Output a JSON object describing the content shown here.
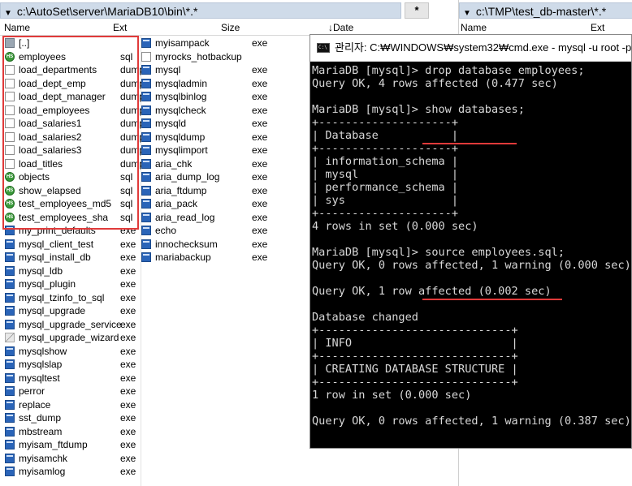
{
  "left_panel": {
    "path": "c:\\AutoSet\\server\\MariaDB10\\bin\\*.*",
    "columns": {
      "name": "Name",
      "ext": "Ext",
      "size": "Size",
      "date": "Date"
    },
    "sort_indicator": "↓",
    "col1": [
      {
        "name": "[..]",
        "ext": "",
        "icon": "up-folder-icon"
      },
      {
        "name": "employees",
        "ext": "sql",
        "icon": "sql-file-icon"
      },
      {
        "name": "load_departments",
        "ext": "dump",
        "icon": "document-icon"
      },
      {
        "name": "load_dept_emp",
        "ext": "dump",
        "icon": "document-icon"
      },
      {
        "name": "load_dept_manager",
        "ext": "dump",
        "icon": "document-icon"
      },
      {
        "name": "load_employees",
        "ext": "dump",
        "icon": "document-icon"
      },
      {
        "name": "load_salaries1",
        "ext": "dump",
        "icon": "document-icon"
      },
      {
        "name": "load_salaries2",
        "ext": "dump",
        "icon": "document-icon"
      },
      {
        "name": "load_salaries3",
        "ext": "dump",
        "icon": "document-icon"
      },
      {
        "name": "load_titles",
        "ext": "dump",
        "icon": "document-icon"
      },
      {
        "name": "objects",
        "ext": "sql",
        "icon": "sql-file-icon"
      },
      {
        "name": "show_elapsed",
        "ext": "sql",
        "icon": "sql-file-icon"
      },
      {
        "name": "test_employees_md5",
        "ext": "sql",
        "icon": "sql-file-icon"
      },
      {
        "name": "test_employees_sha",
        "ext": "sql",
        "icon": "sql-file-icon"
      },
      {
        "name": "my_print_defaults",
        "ext": "exe",
        "icon": "exe-file-icon"
      },
      {
        "name": "mysql_client_test",
        "ext": "exe",
        "icon": "exe-file-icon"
      },
      {
        "name": "mysql_install_db",
        "ext": "exe",
        "icon": "exe-file-icon"
      },
      {
        "name": "mysql_ldb",
        "ext": "exe",
        "icon": "exe-file-icon"
      },
      {
        "name": "mysql_plugin",
        "ext": "exe",
        "icon": "exe-file-icon"
      },
      {
        "name": "mysql_tzinfo_to_sql",
        "ext": "exe",
        "icon": "exe-file-icon"
      },
      {
        "name": "mysql_upgrade",
        "ext": "exe",
        "icon": "exe-file-icon"
      },
      {
        "name": "mysql_upgrade_service",
        "ext": "exe",
        "icon": "exe-file-icon"
      },
      {
        "name": "mysql_upgrade_wizard",
        "ext": "exe",
        "icon": "wizard-file-icon"
      },
      {
        "name": "mysqlshow",
        "ext": "exe",
        "icon": "exe-file-icon"
      },
      {
        "name": "mysqlslap",
        "ext": "exe",
        "icon": "exe-file-icon"
      },
      {
        "name": "mysqltest",
        "ext": "exe",
        "icon": "exe-file-icon"
      },
      {
        "name": "perror",
        "ext": "exe",
        "icon": "exe-file-icon"
      },
      {
        "name": "replace",
        "ext": "exe",
        "icon": "exe-file-icon"
      },
      {
        "name": "sst_dump",
        "ext": "exe",
        "icon": "exe-file-icon"
      },
      {
        "name": "mbstream",
        "ext": "exe",
        "icon": "exe-file-icon"
      },
      {
        "name": "myisam_ftdump",
        "ext": "exe",
        "icon": "exe-file-icon"
      },
      {
        "name": "myisamchk",
        "ext": "exe",
        "icon": "exe-file-icon"
      },
      {
        "name": "myisamlog",
        "ext": "exe",
        "icon": "exe-file-icon"
      }
    ],
    "col2": [
      {
        "name": "myisampack",
        "ext": "exe",
        "icon": "exe-file-icon"
      },
      {
        "name": "myrocks_hotbackup",
        "ext": "",
        "icon": "document-icon"
      },
      {
        "name": "mysql",
        "ext": "exe",
        "icon": "exe-file-icon"
      },
      {
        "name": "mysqladmin",
        "ext": "exe",
        "icon": "exe-file-icon"
      },
      {
        "name": "mysqlbinlog",
        "ext": "exe",
        "icon": "exe-file-icon"
      },
      {
        "name": "mysqlcheck",
        "ext": "exe",
        "icon": "exe-file-icon"
      },
      {
        "name": "mysqld",
        "ext": "exe",
        "icon": "exe-file-icon"
      },
      {
        "name": "mysqldump",
        "ext": "exe",
        "icon": "exe-file-icon"
      },
      {
        "name": "mysqlimport",
        "ext": "exe",
        "icon": "exe-file-icon"
      },
      {
        "name": "aria_chk",
        "ext": "exe",
        "icon": "exe-file-icon"
      },
      {
        "name": "aria_dump_log",
        "ext": "exe",
        "icon": "exe-file-icon"
      },
      {
        "name": "aria_ftdump",
        "ext": "exe",
        "icon": "exe-file-icon"
      },
      {
        "name": "aria_pack",
        "ext": "exe",
        "icon": "exe-file-icon"
      },
      {
        "name": "aria_read_log",
        "ext": "exe",
        "icon": "exe-file-icon"
      },
      {
        "name": "echo",
        "ext": "exe",
        "icon": "exe-file-icon"
      },
      {
        "name": "innochecksum",
        "ext": "exe",
        "icon": "exe-file-icon"
      },
      {
        "name": "mariabackup",
        "ext": "exe",
        "icon": "exe-file-icon"
      }
    ]
  },
  "filter_button": "*",
  "right_panel": {
    "path": "c:\\TMP\\test_db-master\\*.*",
    "columns": {
      "name": "Name",
      "ext": "Ext"
    }
  },
  "cmd": {
    "title": "관리자: C:₩WINDOWS₩system32₩cmd.exe - mysql  -u root -p",
    "lines": [
      "MariaDB [mysql]> drop database employees;",
      "Query OK, 4 rows affected (0.477 sec)",
      "",
      "MariaDB [mysql]> show databases;",
      "+--------------------+",
      "| Database           |",
      "+--------------------+",
      "| information_schema |",
      "| mysql              |",
      "| performance_schema |",
      "| sys                |",
      "+--------------------+",
      "4 rows in set (0.000 sec)",
      "",
      "MariaDB [mysql]> source employees.sql;",
      "Query OK, 0 rows affected, 1 warning (0.000 sec)",
      "",
      "Query OK, 1 row affected (0.002 sec)",
      "",
      "Database changed",
      "+-----------------------------+",
      "| INFO                        |",
      "+-----------------------------+",
      "| CREATING DATABASE STRUCTURE |",
      "+-----------------------------+",
      "1 row in set (0.000 sec)",
      "",
      "Query OK, 0 rows affected, 1 warning (0.387 sec)"
    ]
  },
  "colors": {
    "path_bar": "#cfdbe9",
    "highlight_box": "#e03a3a",
    "terminal_bg": "#000000",
    "terminal_text": "#d8d8d8"
  }
}
